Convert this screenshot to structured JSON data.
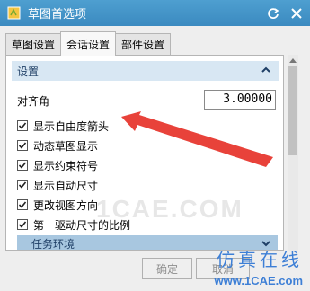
{
  "window": {
    "title": "草图首选项"
  },
  "tabs": [
    {
      "label": "草图设置"
    },
    {
      "label": "会话设置"
    },
    {
      "label": "部件设置"
    }
  ],
  "settings_group": {
    "header": "设置",
    "angle": {
      "label": "对齐角",
      "value": "3.00000"
    },
    "checkboxes": [
      {
        "label": "显示自由度箭头",
        "checked": true
      },
      {
        "label": "动态草图显示",
        "checked": true
      },
      {
        "label": "显示约束符号",
        "checked": true
      },
      {
        "label": "显示自动尺寸",
        "checked": true
      },
      {
        "label": "更改视图方向",
        "checked": true
      },
      {
        "label": "第一驱动尺寸的比例",
        "checked": true
      }
    ]
  },
  "env_group": {
    "header": "任务环境"
  },
  "buttons": {
    "ok": "确定",
    "cancel": "取消"
  },
  "watermark": "1CAE.COM",
  "brand": {
    "name": "仿真在线",
    "url": "www.1CAE.com"
  },
  "colors": {
    "titlebar": "#3b8ac0",
    "group_header": "#d8e7f3",
    "annotation_arrow": "#e8423a"
  }
}
